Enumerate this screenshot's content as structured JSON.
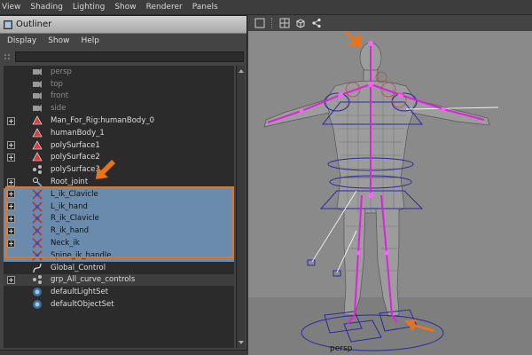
{
  "menubar": {
    "items": [
      "View",
      "Shading",
      "Lighting",
      "Show",
      "Renderer",
      "Panels"
    ]
  },
  "outliner": {
    "title": "Outliner",
    "menu": [
      "Display",
      "Show",
      "Help"
    ],
    "rows": [
      {
        "name": "persp",
        "icon": "camera-icon",
        "kind": "cam",
        "expand": false
      },
      {
        "name": "top",
        "icon": "camera-icon",
        "kind": "cam",
        "expand": false
      },
      {
        "name": "front",
        "icon": "camera-icon",
        "kind": "cam",
        "expand": false
      },
      {
        "name": "side",
        "icon": "camera-icon",
        "kind": "cam",
        "expand": false
      },
      {
        "name": "Man_For_Rig:humanBody_0",
        "icon": "mesh-icon",
        "kind": "obj",
        "expand": true
      },
      {
        "name": "humanBody_1",
        "icon": "mesh-icon",
        "kind": "obj",
        "expand": false
      },
      {
        "name": "polySurface1",
        "icon": "mesh-icon",
        "kind": "obj",
        "expand": true
      },
      {
        "name": "polySurface2",
        "icon": "mesh-icon",
        "kind": "obj",
        "expand": true
      },
      {
        "name": "polySurface3",
        "icon": "group-icon",
        "kind": "obj",
        "expand": false
      },
      {
        "name": "Root_joint",
        "icon": "joint-icon",
        "kind": "obj",
        "expand": true
      },
      {
        "name": "L_ik_Clavicle",
        "icon": "ik-handle-icon",
        "kind": "sel",
        "expand": true
      },
      {
        "name": "L_ik_hand",
        "icon": "ik-handle-icon",
        "kind": "sel",
        "expand": true
      },
      {
        "name": "R_ik_Clavicle",
        "icon": "ik-handle-icon",
        "kind": "sel",
        "expand": true
      },
      {
        "name": "R_ik_hand",
        "icon": "ik-handle-icon",
        "kind": "sel",
        "expand": true
      },
      {
        "name": "Neck_ik",
        "icon": "ik-handle-icon",
        "kind": "sel",
        "expand": true
      },
      {
        "name": "Spine_ik_handle",
        "icon": "ik-handle-icon",
        "kind": "sel",
        "expand": false
      },
      {
        "name": "Global_Control",
        "icon": "curve-icon",
        "kind": "obj",
        "expand": false
      },
      {
        "name": "grp_All_curve_controls",
        "icon": "group-icon",
        "kind": "hl",
        "expand": true
      },
      {
        "name": "defaultLightSet",
        "icon": "set-icon",
        "kind": "obj",
        "expand": false
      },
      {
        "name": "defaultObjectSet",
        "icon": "set-icon",
        "kind": "obj",
        "expand": false
      }
    ]
  },
  "viewport": {
    "camera_label": "persp"
  },
  "colors": {
    "selection": "#6a8bab",
    "annotation": "#e8731d",
    "skeleton": "#e020e0",
    "control": "#2a2aa0"
  }
}
